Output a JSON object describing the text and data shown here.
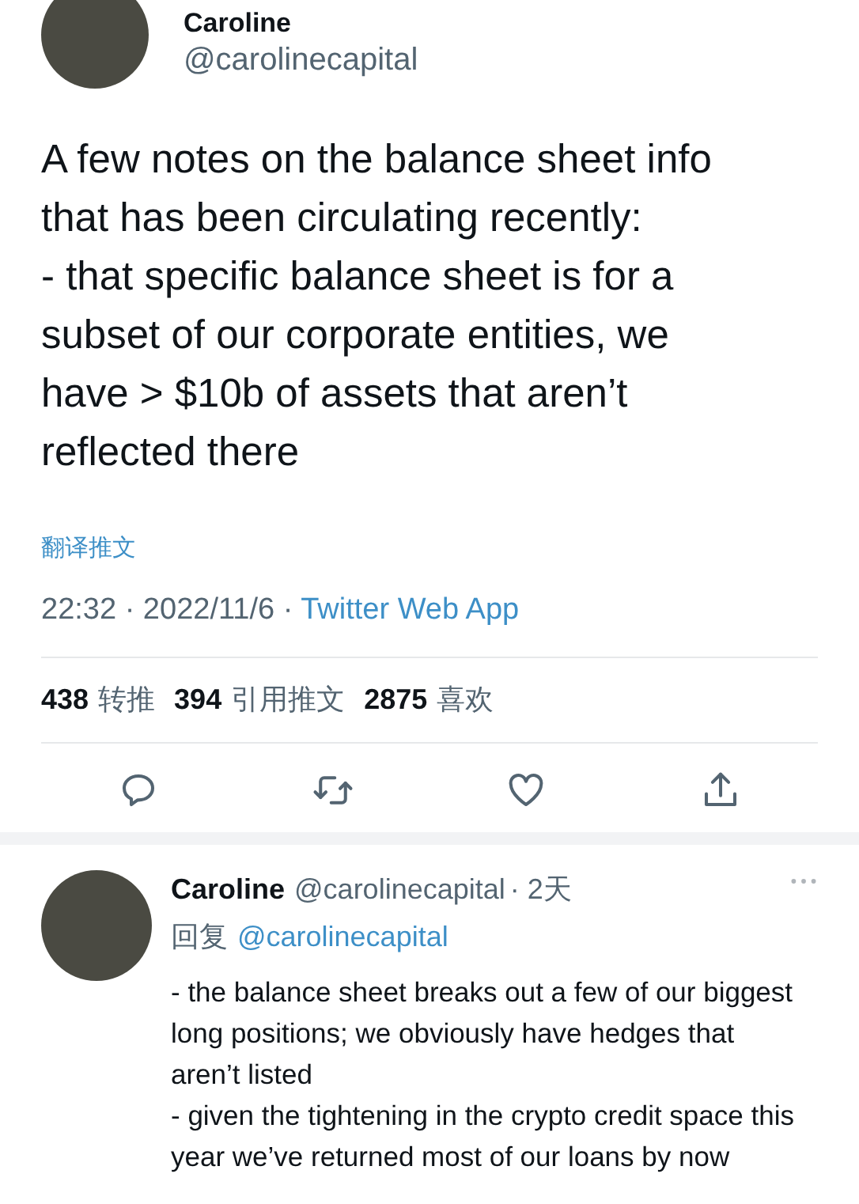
{
  "tweet": {
    "author": {
      "name": "Caroline",
      "handle": "@carolinecapital"
    },
    "text": "A few notes on the balance sheet info that has been circulating recently:\n- that specific balance sheet is for a subset of our corporate entities, we have > $10b of assets that aren’t reflected there",
    "translate": "翻译推文",
    "time": "22:32 · 2022/11/6 · ",
    "source": "Twitter Web App",
    "stats": [
      {
        "count": "438",
        "label": "转推"
      },
      {
        "count": "394",
        "label": "引用推文"
      },
      {
        "count": "2875",
        "label": "喜欢"
      }
    ],
    "actions": [
      {
        "kind": "reply"
      },
      {
        "kind": "retweet"
      },
      {
        "kind": "like"
      },
      {
        "kind": "share"
      }
    ]
  },
  "reply": {
    "name": "Caroline",
    "handle": "@carolinecapital",
    "age": "· 2天",
    "reply_label": "回复",
    "reply_to": "@carolinecapital",
    "text": "- the balance sheet breaks out a few of our biggest long positions; we obviously have hedges that aren’t listed\n- given the tightening in the crypto credit space this year we’ve returned most of our loans by now"
  }
}
